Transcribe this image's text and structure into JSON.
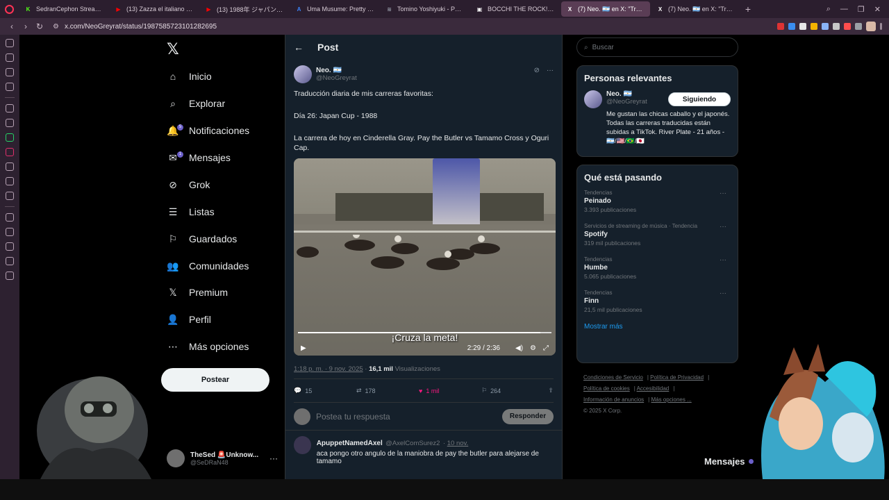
{
  "browser": {
    "tabs": [
      {
        "title": "SedranCephon Stream - V",
        "favicon": "K",
        "color": "#53fc18",
        "active": false
      },
      {
        "title": "(13) Zazza el italiano - Yo",
        "favicon": "▶",
        "color": "#ff0000",
        "active": false
      },
      {
        "title": "(13) 1988年 ジャパンカップ ",
        "favicon": "▶",
        "color": "#ff0000",
        "active": false
      },
      {
        "title": "Uma Musume: Pretty Der",
        "favicon": "A",
        "color": "#3b82f6",
        "active": false
      },
      {
        "title": "Tomino Yoshiyuki - Perso",
        "favicon": "≋",
        "color": "#9ca3af",
        "active": false
      },
      {
        "title": "BOCCHI THE ROCK! | Se",
        "favicon": "▣",
        "color": "#ffffff",
        "active": false
      },
      {
        "title": "(7) Neo. 🇦🇷 en X: \"Traduc",
        "favicon": "X",
        "color": "#ffffff",
        "active": true
      },
      {
        "title": "(7) Neo. 🇦🇷 en X: \"Traduc",
        "favicon": "X",
        "color": "#ffffff",
        "active": false
      }
    ],
    "url": "x.com/NeoGreyrat/status/1987585723101282695",
    "new_tab": "+"
  },
  "nav": {
    "items": [
      {
        "label": "Inicio",
        "icon": "home-icon"
      },
      {
        "label": "Explorar",
        "icon": "search-icon"
      },
      {
        "label": "Notificaciones",
        "icon": "bell-icon",
        "badge": "5"
      },
      {
        "label": "Mensajes",
        "icon": "mail-icon",
        "badge": "1"
      },
      {
        "label": "Grok",
        "icon": "grok-icon"
      },
      {
        "label": "Listas",
        "icon": "list-icon"
      },
      {
        "label": "Guardados",
        "icon": "bookmark-icon"
      },
      {
        "label": "Comunidades",
        "icon": "people-icon"
      },
      {
        "label": "Premium",
        "icon": "x-icon"
      },
      {
        "label": "Perfil",
        "icon": "person-icon"
      },
      {
        "label": "Más opciones",
        "icon": "more-circle-icon"
      }
    ],
    "post_button": "Postear"
  },
  "account": {
    "name": "TheSed 🚨Unknow...",
    "handle": "@SeDRaN48"
  },
  "main": {
    "title": "Post",
    "tweet": {
      "name": "Neo. 🇦🇷",
      "handle": "@NeoGreyrat",
      "paragraphs": [
        "Traducción diaria de mis carreras favoritas:",
        "Día 26: Japan Cup - 1988",
        "La carrera de hoy en Cinderella Gray. Pay the Butler vs Tamamo Cross y Oguri Cap."
      ],
      "video": {
        "subtitle": "¡Cruza la meta!",
        "time": "2:29 / 2:36",
        "progress": 0.955
      },
      "timestamp": "1:18 p. m. · 9 nov. 2025",
      "views_count": "16,1 mil",
      "views_label": "Visualizaciones",
      "stats": {
        "replies": "15",
        "reposts": "178",
        "likes": "1 mil",
        "bookmarks": "264"
      }
    },
    "reply_placeholder": "Postea tu respuesta",
    "reply_button": "Responder",
    "reply": {
      "name": "ApuppetNamedAxel",
      "handle": "@AxelComSurez2",
      "date": "10 nov.",
      "text": "aca pongo otro angulo de la maniobra de pay the butler para alejarse de tamamo"
    }
  },
  "right": {
    "search_placeholder": "Buscar",
    "relevant": {
      "title": "Personas relevantes",
      "name": "Neo. 🇦🇷",
      "handle": "@NeoGreyrat",
      "button": "Siguiendo",
      "bio": "Me gustan las chicas caballo y el japonés. Todas las carreras traducidas están subidas a TikTok. River Plate - 21 años - 🇦🇷/🇺🇸/🇧🇷/🇯🇵"
    },
    "trends": {
      "title": "Qué está pasando",
      "items": [
        {
          "context": "Tendencias",
          "name": "Peinado",
          "count": "3.393 publicaciones"
        },
        {
          "context": "Servicios de streaming de música · Tendencia",
          "name": "Spotify",
          "count": "319 mil publicaciones"
        },
        {
          "context": "Tendencias",
          "name": "Humbe",
          "count": "5.065 publicaciones"
        },
        {
          "context": "Tendencias",
          "name": "Finn",
          "count": "21,5 mil publicaciones"
        }
      ],
      "show_more": "Mostrar más"
    },
    "footer": {
      "links": [
        "Condiciones de Servicio",
        "Política de Privacidad",
        "Política de cookies",
        "Accesibilidad",
        "Información de anuncios",
        "Más opciones ..."
      ],
      "copyright": "© 2025 X Corp."
    },
    "messages_drawer": "Mensajes"
  }
}
